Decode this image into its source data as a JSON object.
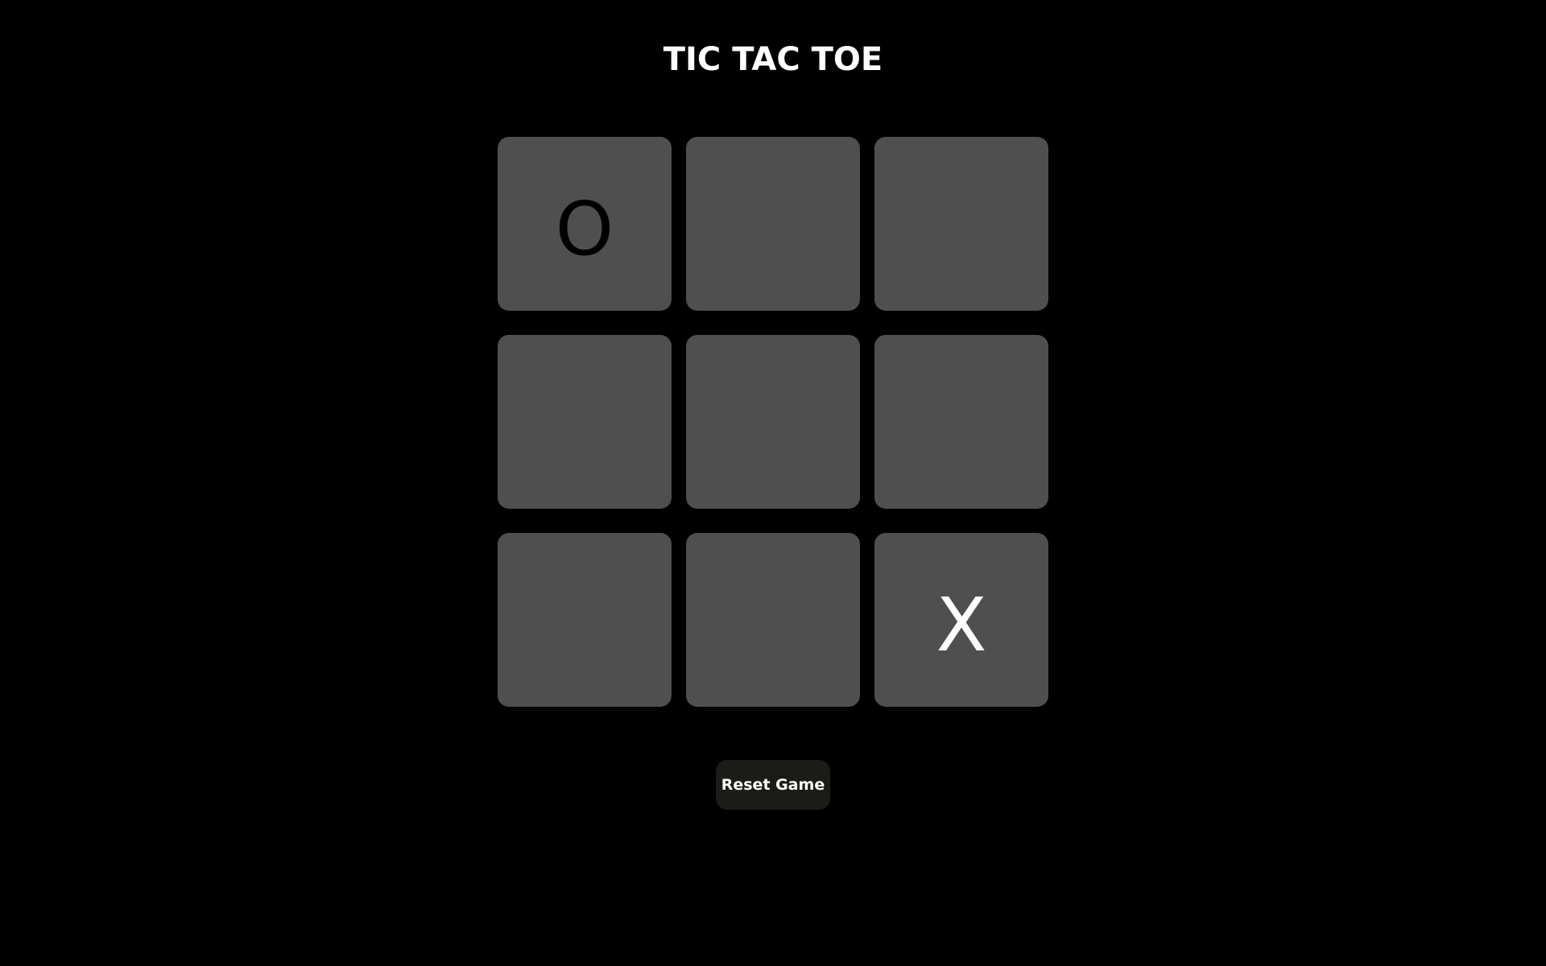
{
  "title": "TIC TAC TOE",
  "colors": {
    "background": "#000000",
    "cell_background": "#4f4f4f",
    "o_mark": "#000000",
    "x_mark": "#ffffff",
    "button_background": "#1b1b18",
    "button_text": "#ffffff"
  },
  "board": {
    "cells": [
      "O",
      "",
      "",
      "",
      "",
      "",
      "",
      "",
      "X"
    ]
  },
  "reset_button": {
    "label": "Reset Game"
  }
}
